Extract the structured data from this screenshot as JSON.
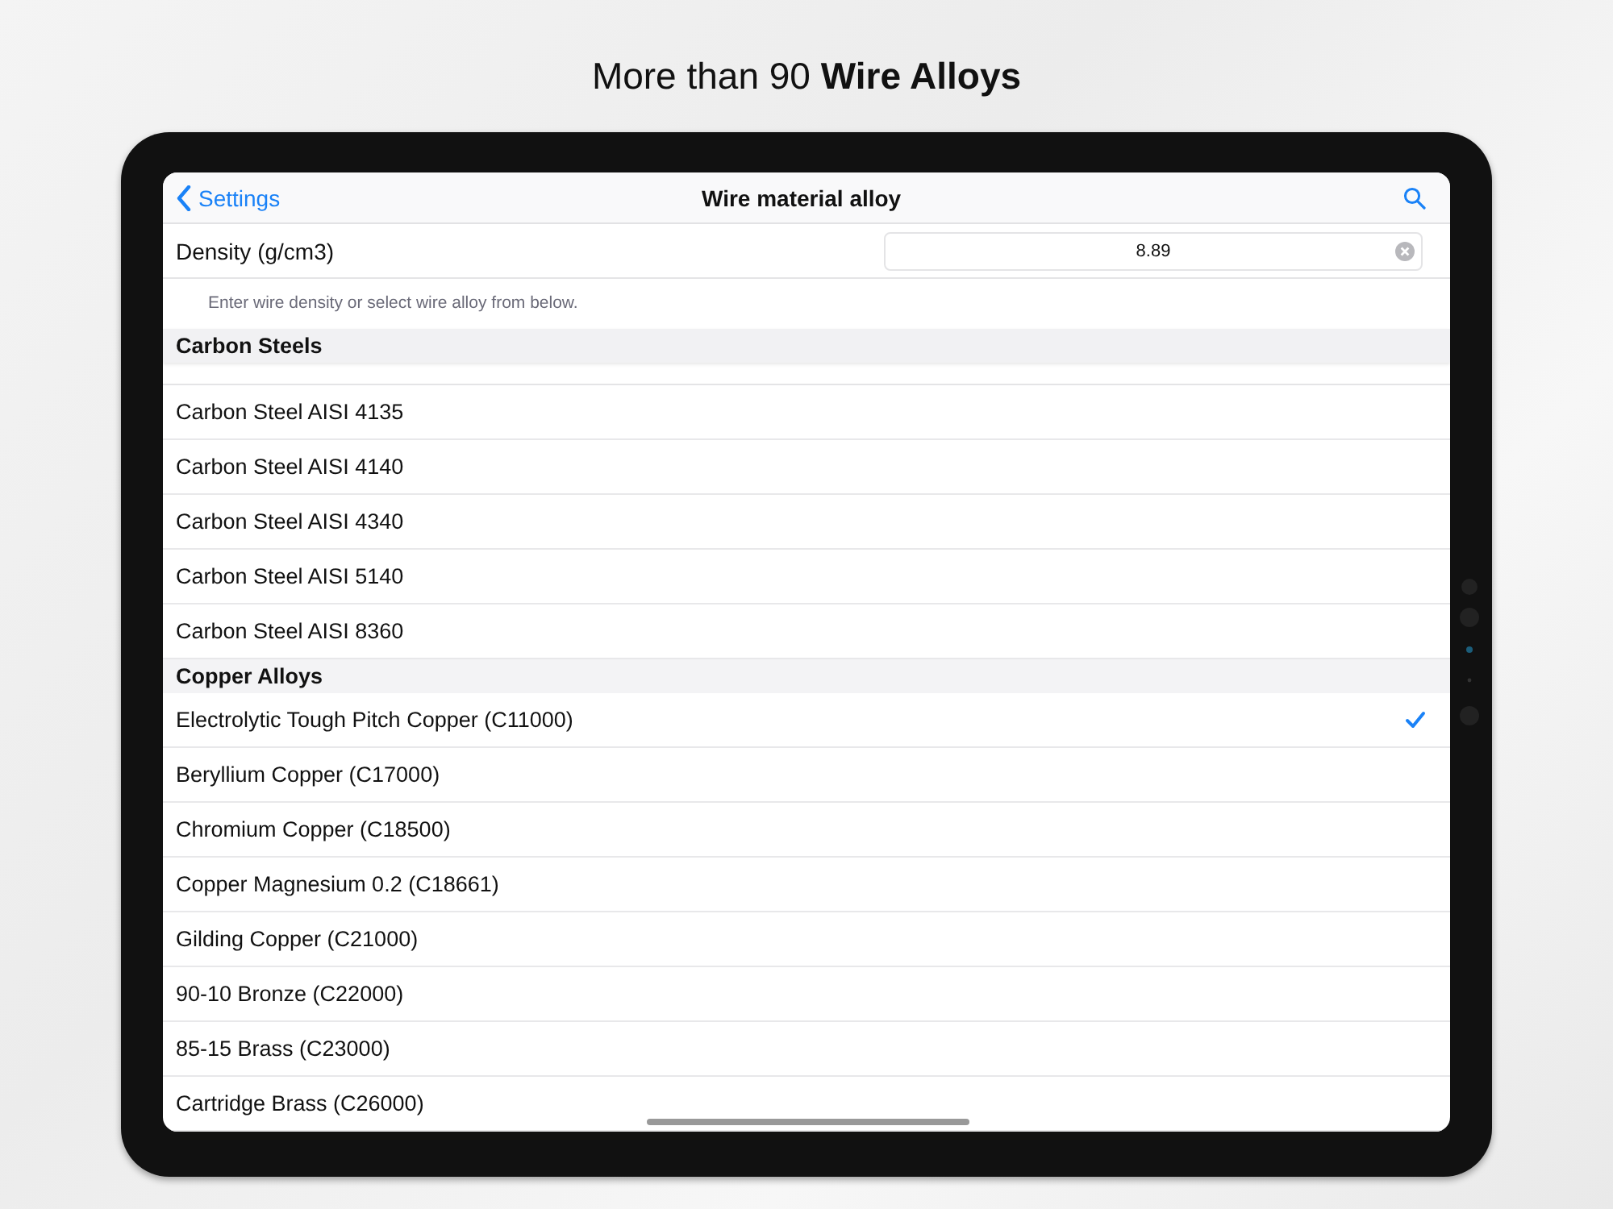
{
  "headline": "More than 90 **Wire Alloys**",
  "nav": {
    "back": "Settings",
    "title": "Wire material alloy"
  },
  "density": {
    "label": "Density (g/cm3)",
    "value": "8.89"
  },
  "hint": "Enter wire density or select wire alloy from below.",
  "sections": [
    {
      "title": "Carbon Steels",
      "clipped_top": true,
      "items": [
        {
          "name": "Carbon Steel AISI 4135",
          "selected": false
        },
        {
          "name": "Carbon Steel AISI 4140",
          "selected": false
        },
        {
          "name": "Carbon Steel AISI 4340",
          "selected": false
        },
        {
          "name": "Carbon Steel AISI 5140",
          "selected": false
        },
        {
          "name": "Carbon Steel AISI 8360",
          "selected": false
        }
      ]
    },
    {
      "title": "Copper Alloys",
      "clipped_top": false,
      "items": [
        {
          "name": "Electrolytic Tough Pitch Copper (C11000)",
          "selected": true
        },
        {
          "name": "Beryllium Copper (C17000)",
          "selected": false
        },
        {
          "name": "Chromium Copper (C18500)",
          "selected": false
        },
        {
          "name": "Copper Magnesium 0.2 (C18661)",
          "selected": false
        },
        {
          "name": "Gilding Copper (C21000)",
          "selected": false
        },
        {
          "name": "90-10 Bronze (C22000)",
          "selected": false
        },
        {
          "name": "85-15 Brass (C23000)",
          "selected": false
        },
        {
          "name": "Cartridge Brass (C26000)",
          "selected": false
        }
      ]
    }
  ]
}
